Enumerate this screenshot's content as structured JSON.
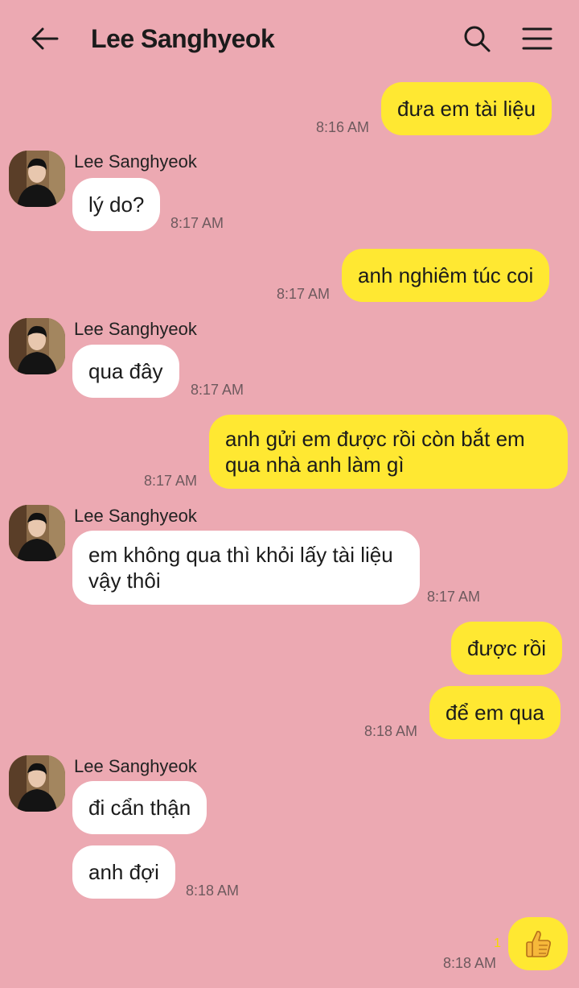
{
  "header": {
    "title": "Lee Sanghyeok",
    "back_icon": "arrow-left-icon",
    "search_icon": "search-icon",
    "menu_icon": "hamburger-menu-icon"
  },
  "colors": {
    "background": "#eca9b2",
    "my_bubble": "#ffe832",
    "their_bubble": "#ffffff",
    "unread_count": "#f5d800"
  },
  "messages": [
    {
      "from": "me",
      "text": "đưa em tài liệu",
      "time": "8:16 AM"
    },
    {
      "from": "them",
      "sender": "Lee Sanghyeok",
      "text": "lý do?",
      "time": "8:17 AM"
    },
    {
      "from": "me",
      "text": "anh nghiêm túc coi",
      "time": "8:17 AM"
    },
    {
      "from": "them",
      "sender": "Lee Sanghyeok",
      "text": "qua đây",
      "time": "8:17 AM"
    },
    {
      "from": "me",
      "text": "anh gửi em được rồi còn bắt em qua nhà anh làm gì",
      "time": "8:17 AM"
    },
    {
      "from": "them",
      "sender": "Lee Sanghyeok",
      "text": "em không qua thì khỏi lấy tài liệu vậy thôi",
      "time": "8:17 AM"
    },
    {
      "from": "me",
      "text": "được rồi"
    },
    {
      "from": "me",
      "text": "để em qua",
      "time": "8:18 AM"
    },
    {
      "from": "them",
      "sender": "Lee Sanghyeok",
      "text": "đi cẩn thận"
    },
    {
      "from": "them",
      "text": "anh đợi",
      "time": "8:18 AM"
    },
    {
      "from": "me",
      "emoji": "👍",
      "icon": "thumbs-up-icon",
      "unread": "1",
      "time": "8:18 AM"
    }
  ]
}
